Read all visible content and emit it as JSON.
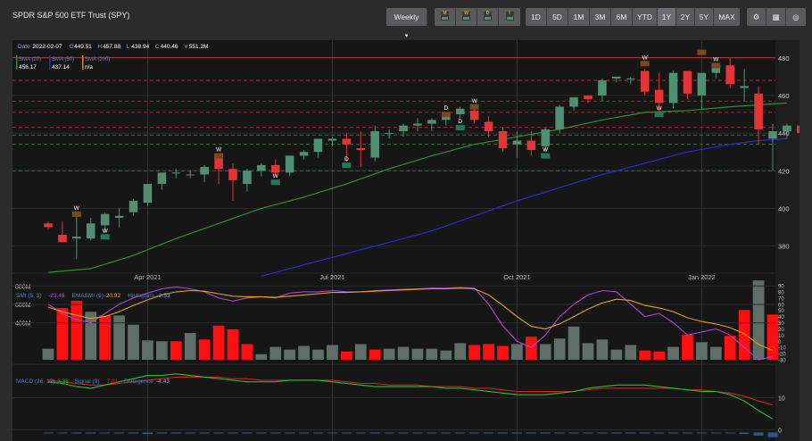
{
  "header": {
    "title": "SPDR S&P 500 ETF Trust (SPY)"
  },
  "toolbar": {
    "interval_label": "Weekly",
    "interval_caret": "▾",
    "indicator_buttons": [
      {
        "label": "M",
        "name": "indicator-m-button"
      },
      {
        "label": "W",
        "name": "indicator-w-button"
      },
      {
        "label": "D",
        "name": "indicator-d-button"
      },
      {
        "label": "I",
        "name": "indicator-i-button"
      }
    ],
    "ranges": [
      "1D",
      "5D",
      "1M",
      "3M",
      "6M",
      "YTD",
      "1Y",
      "2Y",
      "5Y",
      "MAX"
    ],
    "selected_range": "1Y",
    "tools": [
      {
        "icon": "gear-icon",
        "glyph": "⚙"
      },
      {
        "icon": "calculator-icon",
        "glyph": "▦"
      },
      {
        "icon": "layers-icon",
        "glyph": "◎"
      }
    ]
  },
  "info": {
    "date_label": "Date",
    "date": "2022-02-07",
    "o_label": "O",
    "o": "449.51",
    "h_label": "H",
    "h": "457.88",
    "l_label": "L",
    "l": "438.94",
    "c_label": "C",
    "c": "440.46",
    "v_label": "V",
    "v": "551.2M"
  },
  "colors": {
    "background": "#161616",
    "grid": "#2b2b2b",
    "up": "#4f8f72",
    "down": "#e33535",
    "sma20": "#2f8f2f",
    "sma50": "#2a2ac8",
    "sma200": "#d8872a",
    "smi": "#b040d8",
    "smi_ema": "#e1a020",
    "vol_up": "#5f6e66",
    "vol_down": "#ff1010",
    "macd": "#2bbf2b",
    "signal": "#cc2222",
    "divergence": "#2a5a8a",
    "marker_bg": "#7a4a1a",
    "marker_text": "#e6c200",
    "marker_green": "#1f7a5a",
    "marker_label": "#ffffff"
  },
  "chart_data": {
    "type": "candlestick",
    "price_axis": {
      "ticks": [
        380,
        400,
        420,
        440,
        460,
        480
      ],
      "ylim": [
        367,
        487
      ]
    },
    "x_labels": [
      {
        "week": 7,
        "label": "Apr 2021"
      },
      {
        "week": 20,
        "label": "Jul 2021"
      },
      {
        "week": 33,
        "label": "Oct 2021"
      },
      {
        "week": 46,
        "label": "Jan 2022"
      }
    ],
    "overlays": [
      {
        "label": "SMA (20)",
        "value": "456.17"
      },
      {
        "label": "SMA (50)",
        "value": "437.14"
      },
      {
        "label": "SMA (200)",
        "value": "n/a"
      }
    ],
    "weeks": 52,
    "ohlc": [
      [
        392,
        393,
        389,
        390
      ],
      [
        386,
        393,
        382,
        382
      ],
      [
        384,
        397,
        373,
        385
      ],
      [
        384,
        395,
        383,
        392
      ],
      [
        391,
        398,
        387,
        397
      ],
      [
        395,
        400,
        390,
        396
      ],
      [
        398,
        405,
        396,
        404
      ],
      [
        403,
        413,
        401,
        413
      ],
      [
        413,
        419,
        410,
        419
      ],
      [
        419,
        421,
        416,
        419
      ],
      [
        418,
        420,
        416,
        418
      ],
      [
        418,
        423,
        414,
        422
      ],
      [
        427,
        428,
        413,
        421
      ],
      [
        421,
        424,
        404,
        415
      ],
      [
        413,
        421,
        409,
        420
      ],
      [
        420,
        424,
        417,
        423
      ],
      [
        423,
        426,
        417,
        419
      ],
      [
        419,
        428,
        417,
        428
      ],
      [
        428,
        431,
        426,
        430
      ],
      [
        430,
        437,
        427,
        437
      ],
      [
        436,
        438,
        433,
        437
      ],
      [
        437,
        440,
        425,
        434
      ],
      [
        432,
        441,
        422,
        431
      ],
      [
        427,
        444,
        425,
        441
      ],
      [
        440,
        442,
        437,
        440
      ],
      [
        441,
        445,
        438,
        444
      ],
      [
        444,
        448,
        441,
        445
      ],
      [
        445,
        448,
        441,
        447
      ],
      [
        447,
        451,
        444,
        450
      ],
      [
        450,
        454,
        448,
        453
      ],
      [
        452,
        455,
        445,
        447
      ],
      [
        446,
        449,
        438,
        441
      ],
      [
        441,
        443,
        430,
        432
      ],
      [
        434,
        441,
        427,
        436
      ],
      [
        436,
        441,
        428,
        431
      ],
      [
        433,
        443,
        430,
        442
      ],
      [
        442,
        455,
        440,
        454
      ],
      [
        454,
        458,
        452,
        459
      ],
      [
        460,
        460,
        456,
        458
      ],
      [
        460,
        469,
        457,
        468
      ],
      [
        469,
        470,
        467,
        470
      ],
      [
        469,
        470,
        466,
        469
      ],
      [
        473,
        474,
        460,
        462
      ],
      [
        463,
        472,
        449,
        456
      ],
      [
        456,
        473,
        453,
        472
      ],
      [
        473,
        473,
        458,
        461
      ],
      [
        460,
        472,
        453,
        472
      ],
      [
        472,
        477,
        469,
        476
      ],
      [
        476,
        480,
        464,
        466
      ],
      [
        464,
        474,
        457,
        465
      ],
      [
        461,
        465,
        434,
        442
      ],
      [
        437,
        445,
        420,
        441
      ],
      [
        441,
        445,
        437,
        444
      ],
      [
        444,
        458,
        434,
        440
      ]
    ],
    "sma20": [
      [
        0,
        366
      ],
      [
        3,
        368
      ],
      [
        6,
        375
      ],
      [
        9,
        384
      ],
      [
        12,
        392
      ],
      [
        15,
        400
      ],
      [
        18,
        406
      ],
      [
        21,
        413
      ],
      [
        24,
        421
      ],
      [
        27,
        428
      ],
      [
        30,
        434
      ],
      [
        33,
        438
      ],
      [
        36,
        442
      ],
      [
        39,
        447
      ],
      [
        42,
        451
      ],
      [
        45,
        452
      ],
      [
        48,
        454
      ],
      [
        50,
        455
      ],
      [
        52,
        456
      ]
    ],
    "sma50": [
      [
        15,
        364
      ],
      [
        18,
        370
      ],
      [
        21,
        376
      ],
      [
        24,
        382
      ],
      [
        27,
        388
      ],
      [
        30,
        396
      ],
      [
        33,
        404
      ],
      [
        36,
        411
      ],
      [
        39,
        418
      ],
      [
        42,
        424
      ],
      [
        45,
        430
      ],
      [
        48,
        434
      ],
      [
        50,
        436
      ],
      [
        52,
        437
      ]
    ],
    "horizontal_levels": [
      {
        "value": 480,
        "color": "#e04444",
        "style": "solid"
      },
      {
        "value": 468,
        "color": "#d02a2a",
        "style": "dashed"
      },
      {
        "value": 457,
        "color": "#d02a2a",
        "style": "dashed"
      },
      {
        "value": 451,
        "color": "#d02a2a",
        "style": "dashed"
      },
      {
        "value": 443,
        "color": "#d02a2a",
        "style": "dashed"
      },
      {
        "value": 439,
        "color": "#2f8f2f",
        "style": "dashed"
      },
      {
        "value": 434,
        "color": "#2f8f2f",
        "style": "dashed"
      },
      {
        "value": 420,
        "color": "#2f8f2f",
        "style": "dashed"
      }
    ],
    "markers": [
      {
        "week": 2,
        "label": "W",
        "price": 395,
        "kind": "down"
      },
      {
        "week": 4,
        "label": "W",
        "price": 383,
        "kind": "up"
      },
      {
        "week": 12,
        "label": "W",
        "price": 426,
        "kind": "down"
      },
      {
        "week": 16,
        "label": "W",
        "price": 412,
        "kind": "up"
      },
      {
        "week": 21,
        "label": "D",
        "price": 421,
        "kind": "up"
      },
      {
        "week": 28,
        "label": "D",
        "price": 448,
        "kind": "down"
      },
      {
        "week": 29,
        "label": "D",
        "price": 441,
        "kind": "up"
      },
      {
        "week": 30,
        "label": "W",
        "price": 452,
        "kind": "down"
      },
      {
        "week": 35,
        "label": "W",
        "price": 426,
        "kind": "up"
      },
      {
        "week": 42,
        "label": "W",
        "price": 475,
        "kind": "down"
      },
      {
        "week": 43,
        "label": "W",
        "price": 448,
        "kind": "up"
      },
      {
        "week": 46,
        "label": "",
        "price": 481,
        "kind": "down"
      },
      {
        "week": 47,
        "label": "W",
        "price": 474,
        "kind": "down"
      }
    ],
    "smi_panel": {
      "legend": [
        {
          "label": "SMI (5, 3)",
          "value": "-23.45"
        },
        {
          "label": "EMASMI (5)",
          "value": "-20.92"
        },
        {
          "label": "Histogram",
          "value": "-2.53"
        }
      ],
      "vol_ticks": [
        "800M",
        "600M",
        "400M"
      ],
      "smi_ticks": [
        90,
        80,
        70,
        60,
        50,
        40,
        30,
        20,
        10,
        0,
        -10,
        -20,
        -30
      ],
      "volume": [
        120,
        560,
        640,
        520,
        480,
        480,
        380,
        210,
        200,
        200,
        290,
        220,
        370,
        330,
        170,
        60,
        140,
        110,
        150,
        110,
        160,
        90,
        170,
        110,
        120,
        140,
        120,
        120,
        100,
        180,
        160,
        170,
        150,
        170,
        250,
        170,
        230,
        360,
        180,
        220,
        110,
        160,
        100,
        90,
        140,
        270,
        190,
        140,
        260,
        540,
        860,
        490
      ],
      "volume_up": [
        1,
        0,
        0,
        1,
        0,
        1,
        1,
        1,
        1,
        0,
        1,
        0,
        0,
        0,
        0,
        1,
        1,
        1,
        1,
        1,
        1,
        0,
        1,
        0,
        1,
        1,
        1,
        1,
        1,
        1,
        0,
        0,
        0,
        1,
        0,
        1,
        1,
        1,
        1,
        1,
        1,
        1,
        0,
        0,
        1,
        0,
        1,
        1,
        0,
        0,
        1,
        0
      ],
      "smi": [
        60,
        45,
        35,
        30,
        45,
        60,
        70,
        78,
        85,
        88,
        85,
        80,
        70,
        65,
        70,
        72,
        70,
        78,
        80,
        80,
        82,
        80,
        80,
        82,
        83,
        84,
        85,
        86,
        86,
        87,
        86,
        60,
        25,
        0,
        -10,
        10,
        40,
        60,
        75,
        82,
        80,
        60,
        40,
        45,
        30,
        10,
        15,
        20,
        10,
        -10,
        -30,
        -25
      ],
      "ema": [
        55,
        48,
        42,
        37,
        40,
        48,
        58,
        67,
        75,
        80,
        82,
        81,
        77,
        73,
        72,
        72,
        71,
        73,
        75,
        77,
        79,
        79,
        80,
        81,
        82,
        83,
        84,
        85,
        85,
        86,
        85,
        75,
        58,
        40,
        24,
        20,
        28,
        40,
        52,
        62,
        68,
        66,
        58,
        54,
        48,
        38,
        32,
        28,
        22,
        12,
        -5,
        -15
      ]
    },
    "macd_panel": {
      "legend": [
        {
          "label": "MACD (26, 12)",
          "value": "3.38"
        },
        {
          "label": "Signal (9)",
          "value": "7.81"
        },
        {
          "label": "Divergence",
          "value": "-4.43"
        }
      ],
      "ticks": [
        10,
        0
      ],
      "macd": [
        15,
        14.5,
        13.5,
        13,
        14,
        15,
        16,
        17,
        17,
        17.5,
        17,
        16.5,
        16,
        15.5,
        15,
        15,
        15,
        15.5,
        15.5,
        15.5,
        15,
        14.5,
        14,
        13.5,
        13.5,
        13.5,
        13.5,
        13.5,
        13,
        13,
        12.5,
        12,
        11.5,
        11,
        11,
        11,
        11.5,
        12,
        13,
        13.5,
        14,
        14,
        14,
        13.5,
        13,
        12.5,
        12,
        12,
        11,
        9,
        6,
        3.4
      ],
      "signal": [
        15.5,
        15,
        14.5,
        14,
        14,
        14.5,
        15,
        15.5,
        16,
        16.5,
        16.5,
        16.5,
        16.5,
        16,
        16,
        15.5,
        15.5,
        15.5,
        15.5,
        15.5,
        15.5,
        15,
        14.5,
        14.5,
        14,
        14,
        14,
        13.5,
        13.5,
        13.5,
        13,
        13,
        12.5,
        12,
        12,
        12,
        12,
        12,
        12.5,
        13,
        13,
        13,
        13,
        13,
        13,
        12.5,
        12.5,
        12,
        11.5,
        10.5,
        9,
        7.8
      ],
      "divergence": [
        -0.5,
        -0.5,
        -1,
        -1,
        0,
        0.5,
        1,
        1.5,
        1,
        1,
        0.5,
        0,
        -0.5,
        -0.5,
        -1,
        -0.5,
        -0.5,
        0,
        0,
        0,
        -0.5,
        -0.5,
        -0.5,
        -1,
        -0.5,
        -0.5,
        -0.5,
        0,
        -0.5,
        -0.5,
        -0.5,
        -1,
        -1,
        -1,
        -1,
        -1,
        -0.5,
        0,
        0.5,
        0.5,
        1,
        1,
        1,
        0.5,
        0,
        0,
        -0.5,
        0,
        -0.5,
        -1.5,
        -3,
        -4.4
      ]
    }
  }
}
